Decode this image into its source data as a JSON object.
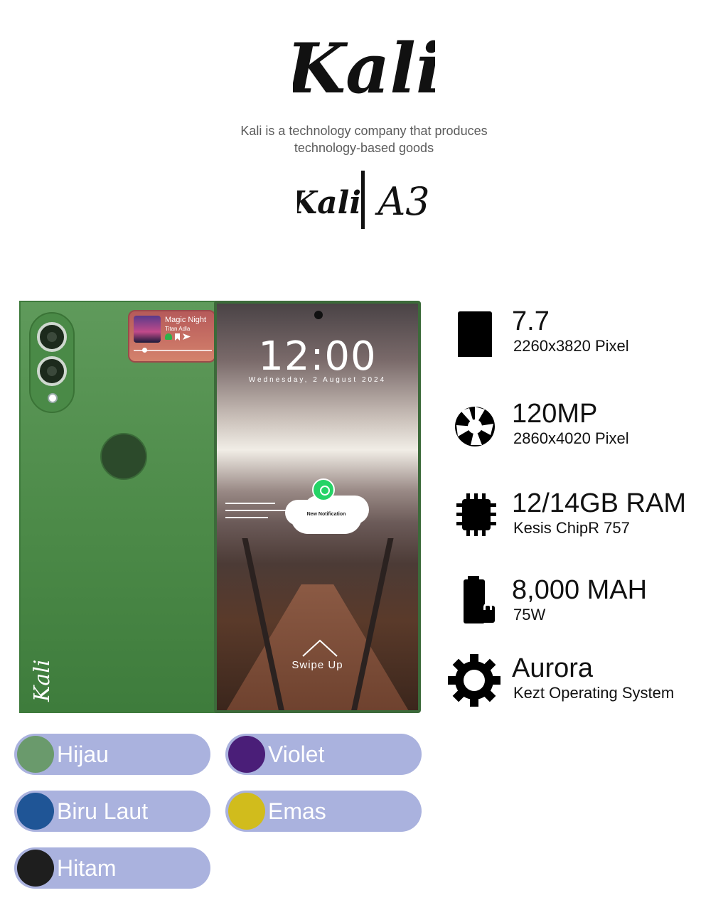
{
  "header": {
    "brand": "Kali",
    "tagline_line1": "Kali is a technology company that produces",
    "tagline_line2": "technology-based goods",
    "model_brand": "Kali",
    "model_name": "A3"
  },
  "phone": {
    "back_brand": "Kali",
    "player": {
      "title": "Magic Night",
      "artist": "Titan Adla"
    },
    "lockscreen": {
      "time": "12:00",
      "date": "Wednesday, 2 August 2024",
      "notification": "New Notification",
      "swipe": "Swipe Up"
    },
    "back_color": "#4c8a48"
  },
  "specs": [
    {
      "icon": "screen-icon",
      "main": "7.7",
      "sub": "2260x3820 Pixel"
    },
    {
      "icon": "aperture-icon",
      "main": "120MP",
      "sub": "2860x4020 Pixel"
    },
    {
      "icon": "chip-icon",
      "main": "12/14GB RAM",
      "sub": "Kesis ChipR 757"
    },
    {
      "icon": "battery-icon",
      "main": "8,000 MAH",
      "sub": "75W"
    },
    {
      "icon": "gear-icon",
      "main": "Aurora",
      "sub": "Kezt Operating System"
    }
  ],
  "colors": [
    {
      "name": "Hijau",
      "hex": "#6a9a6c"
    },
    {
      "name": "Violet",
      "hex": "#4a1e78"
    },
    {
      "name": "Biru Laut",
      "hex": "#1f5596"
    },
    {
      "name": "Emas",
      "hex": "#d1bc1c"
    },
    {
      "name": "Hitam",
      "hex": "#1e1e1e"
    }
  ],
  "pill_color": "#aab2de"
}
